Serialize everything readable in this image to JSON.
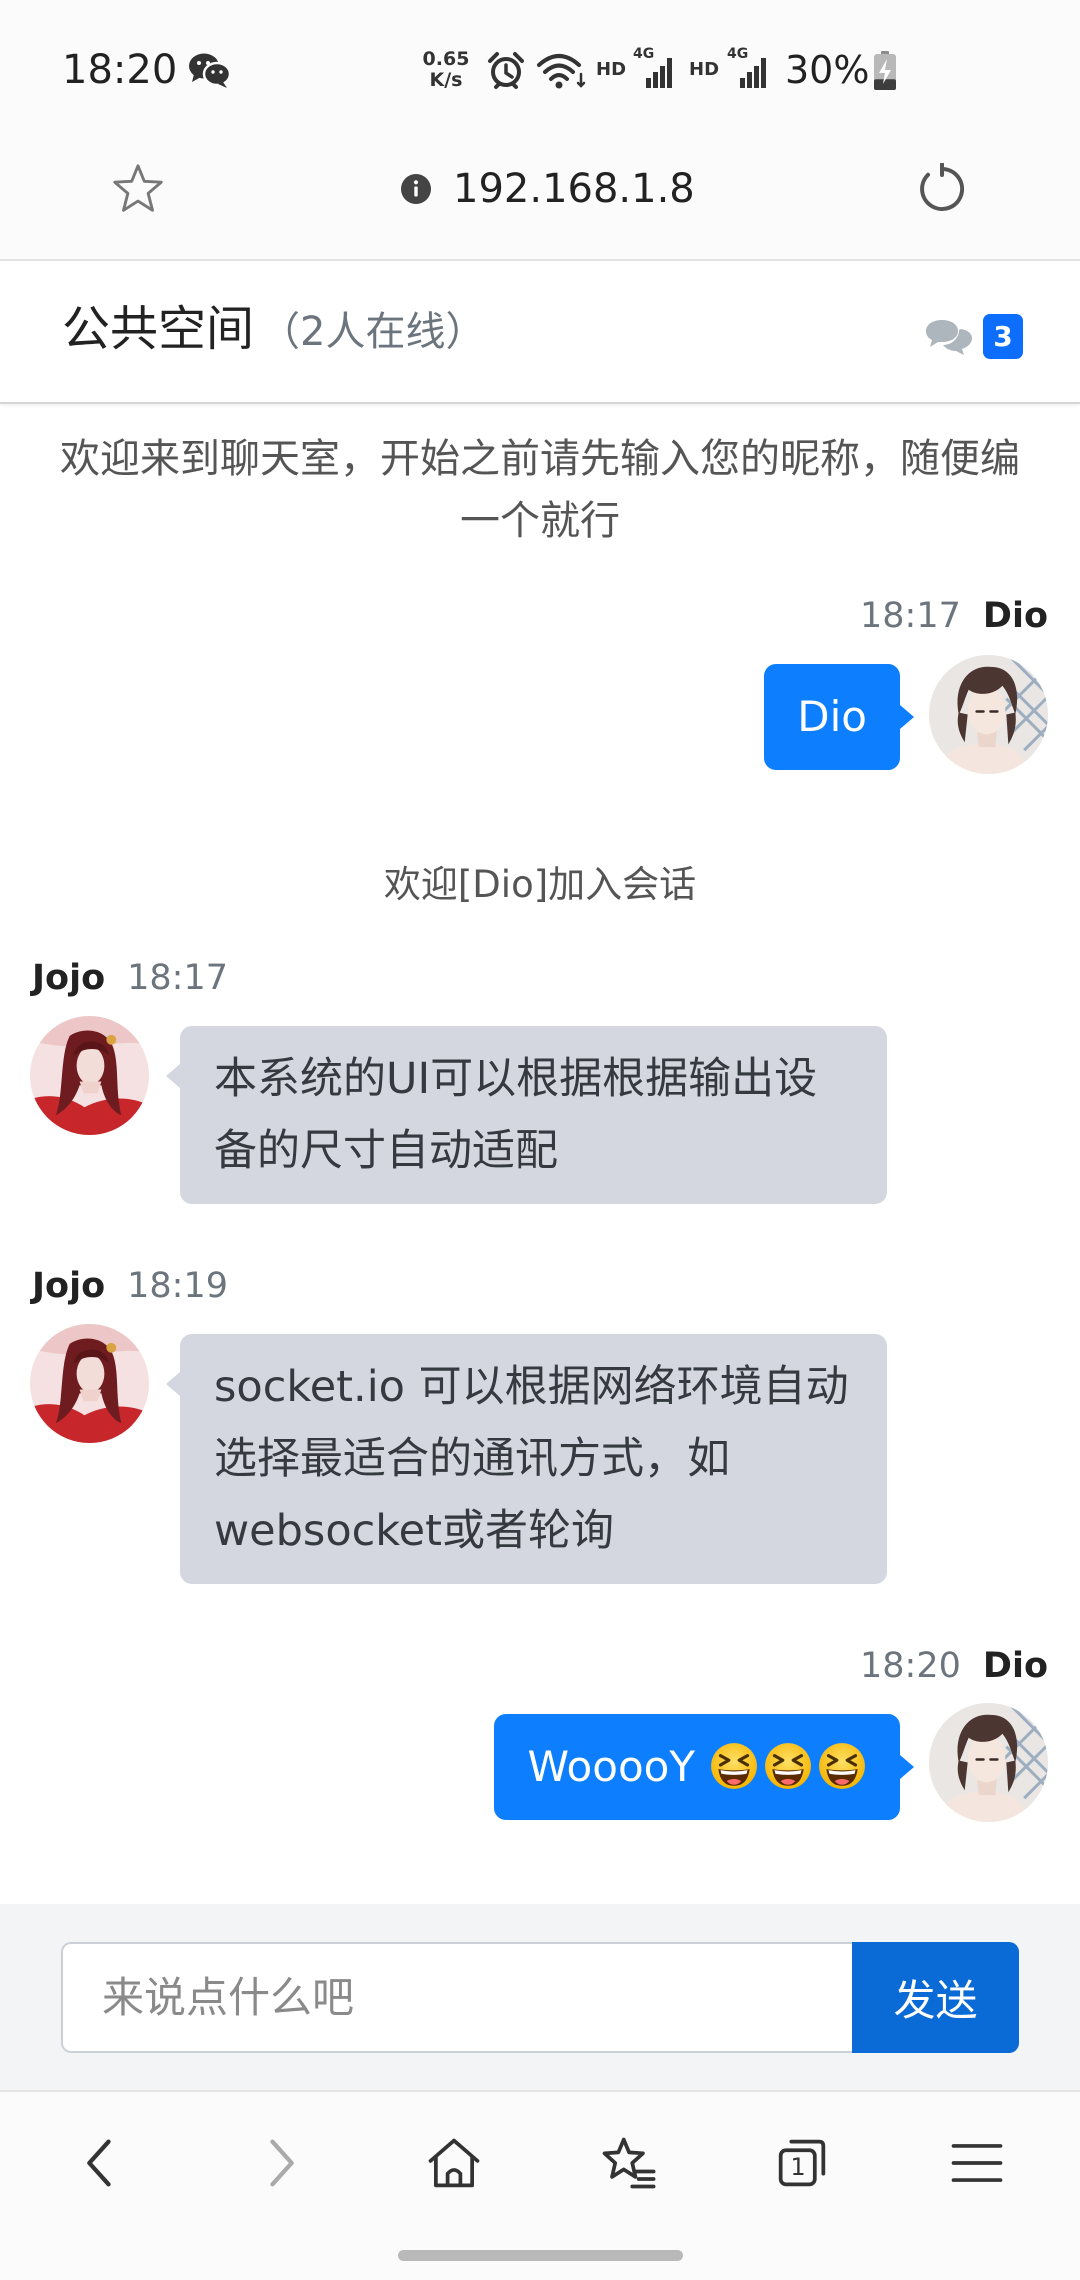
{
  "status_bar": {
    "time": "18:20",
    "net_speed": "0.65",
    "net_speed_unit": "K/s",
    "sim1_label": "HD",
    "sim1_network": "4G",
    "sim2_label": "HD",
    "sim2_network": "4G",
    "battery_percent": "30%",
    "battery_level": 0.3,
    "icons": [
      "wechat-icon",
      "alarm-icon",
      "wifi-icon",
      "signal-icon",
      "signal-icon",
      "battery-charging-icon"
    ]
  },
  "browser": {
    "url": "192.168.1.8",
    "icons": [
      "star-outline-icon",
      "info-icon",
      "reload-icon"
    ]
  },
  "chat_header": {
    "title": "公共空间",
    "online_status": "（2人在线）",
    "unread_badge": "3",
    "icon": "chat-bubbles-icon"
  },
  "welcome_text": "欢迎来到聊天室，开始之前请先输入您的昵称，随便编一个就行",
  "messages": [
    {
      "sender": "Dio",
      "time": "18:17",
      "text": "Dio"
    },
    {
      "text": "欢迎[Dio]加入会话"
    },
    {
      "sender": "Jojo",
      "time": "18:17",
      "text": "本系统的UI可以根据根据输出设备的尺寸自动适配"
    },
    {
      "sender": "Jojo",
      "time": "18:19",
      "text": "socket.io 可以根据网络环境自动选择最适合的通讯方式，如websocket或者轮询"
    },
    {
      "sender": "Dio",
      "time": "18:20",
      "text": "WooooY",
      "emoji": [
        "grinning-squinting-face-icon",
        "grinning-squinting-face-icon",
        "grinning-squinting-face-icon"
      ]
    }
  ],
  "composer": {
    "placeholder": "来说点什么吧",
    "send_label": "发送"
  },
  "bottom_nav": {
    "tab_count": "1",
    "icons": [
      "back-icon",
      "forward-icon",
      "home-icon",
      "bookmarks-icon",
      "tabs-icon",
      "menu-icon"
    ]
  },
  "colors": {
    "own_bubble": "#0d7efd",
    "other_bubble": "#d4d7df",
    "send_button": "#0b6bd6",
    "badge": "#0d6efd",
    "muted_text": "#6c757d"
  }
}
